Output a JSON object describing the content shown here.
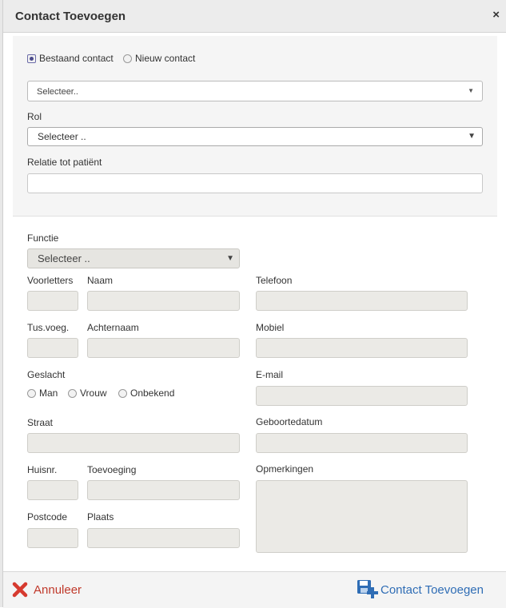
{
  "dialog": {
    "title": "Contact Toevoegen",
    "close": "×"
  },
  "contact_type": {
    "existing": "Bestaand contact",
    "new": "Nieuw contact",
    "selected": "existing"
  },
  "contact_select": {
    "value": "Selecteer.."
  },
  "role": {
    "label": "Rol",
    "value": "Selecteer .."
  },
  "relation": {
    "label": "Relatie tot patiënt",
    "value": ""
  },
  "functie": {
    "label": "Functie",
    "value": "Selecteer .."
  },
  "fields": {
    "voorletters": "Voorletters",
    "naam": "Naam",
    "telefoon": "Telefoon",
    "tusvoeg": "Tus.voeg.",
    "achternaam": "Achternaam",
    "mobiel": "Mobiel",
    "geslacht": "Geslacht",
    "email": "E-mail",
    "straat": "Straat",
    "geboortedatum": "Geboortedatum",
    "huisnr": "Huisnr.",
    "toevoeging": "Toevoeging",
    "opmerkingen": "Opmerkingen",
    "postcode": "Postcode",
    "plaats": "Plaats"
  },
  "gender": {
    "man": "Man",
    "vrouw": "Vrouw",
    "onbekend": "Onbekend"
  },
  "footer": {
    "cancel": "Annuleer",
    "add": "Contact Toevoegen"
  },
  "colors": {
    "cancel": "#c0392b",
    "add": "#2f6db5"
  }
}
